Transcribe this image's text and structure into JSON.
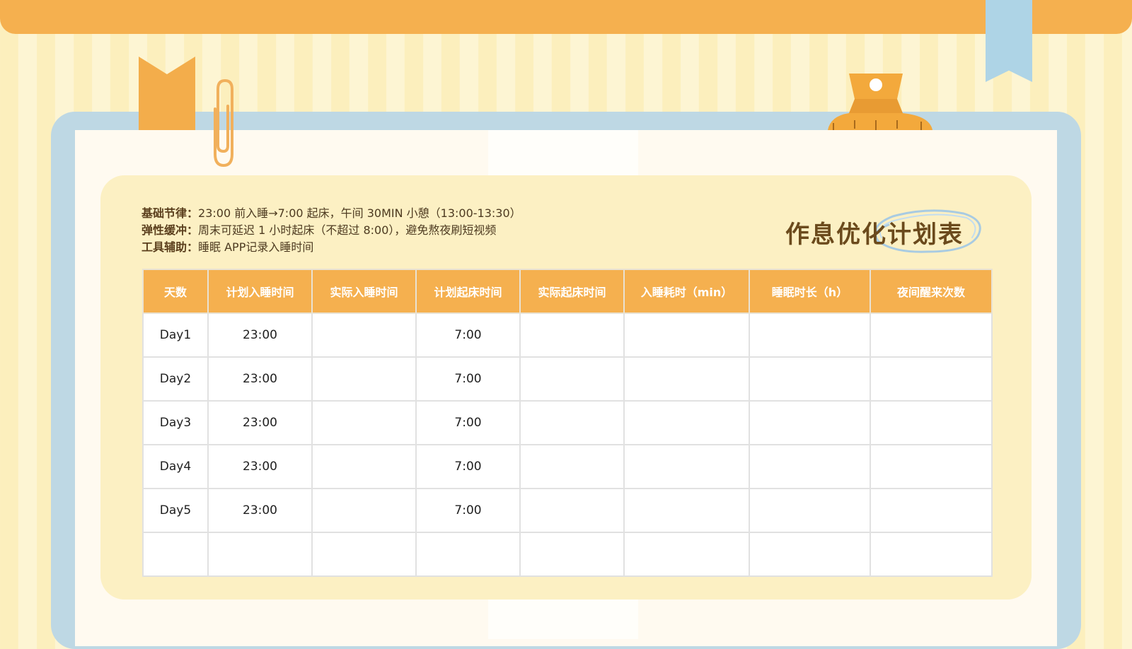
{
  "info": {
    "lines": [
      {
        "label": "基础节律：",
        "text": "23:00 前入睡→7:00 起床，午间 30MIN 小憩（13:00-13:30）"
      },
      {
        "label": "弹性缓冲：",
        "text": "周末可延迟 1 小时起床（不超过 8:00），避免熬夜刷短视频"
      },
      {
        "label": "工具辅助：",
        "text": "睡眠 APP记录入睡时间"
      }
    ]
  },
  "title": "作息优化计划表",
  "table": {
    "headers": [
      "天数",
      "计划入睡时间",
      "实际入睡时间",
      "计划起床时间",
      "实际起床时间",
      "入睡耗时（min）",
      "睡眠时长（h）",
      "夜间醒来次数"
    ],
    "rows": [
      [
        "Day1",
        "23:00",
        "",
        "7:00",
        "",
        "",
        "",
        ""
      ],
      [
        "Day2",
        "23:00",
        "",
        "7:00",
        "",
        "",
        "",
        ""
      ],
      [
        "Day3",
        "23:00",
        "",
        "7:00",
        "",
        "",
        "",
        ""
      ],
      [
        "Day4",
        "23:00",
        "",
        "7:00",
        "",
        "",
        "",
        ""
      ],
      [
        "Day5",
        "23:00",
        "",
        "7:00",
        "",
        "",
        "",
        ""
      ],
      [
        "",
        "",
        "",
        "",
        "",
        "",
        "",
        ""
      ]
    ]
  },
  "colors": {
    "accent_orange": "#f5b04f",
    "ribbon_blue": "#aed4e6",
    "board_blue": "#bed8e4",
    "panel_yellow": "#fcf0c3",
    "title_brown": "#6b4a1c"
  },
  "icons": {
    "bookmark": "bookmark-icon",
    "paperclip": "paperclip-icon",
    "clip": "binder-clip-icon",
    "ribbon": "ribbon-icon",
    "scribble": "scribble-circle-icon"
  }
}
